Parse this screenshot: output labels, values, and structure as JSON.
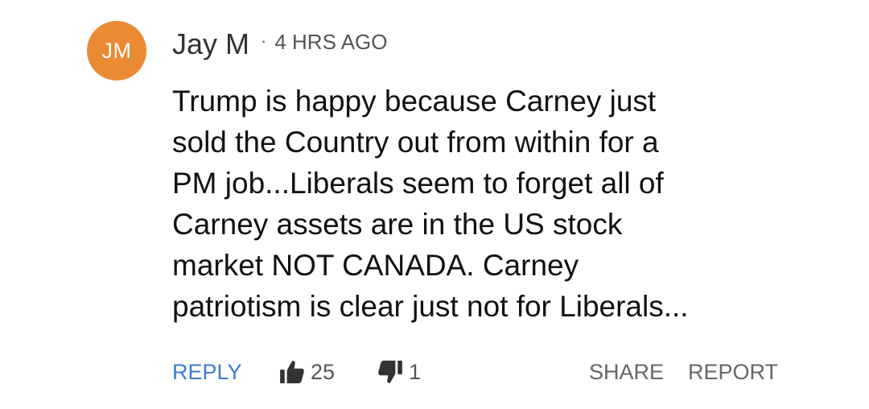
{
  "comment": {
    "avatar_initials": "JM",
    "avatar_color": "#ea8a33",
    "author": "Jay M",
    "separator": "·",
    "timestamp": "4 HRS AGO",
    "lines": [
      "Trump is happy because Carney just",
      "sold the Country out from within for a",
      "PM job...Liberals seem to forget all of",
      "Carney assets are in the US stock",
      "market NOT CANADA. Carney",
      "patriotism is clear just not for Liberals..."
    ]
  },
  "actions": {
    "reply_label": "REPLY",
    "like_icon": "thumbs-up-icon",
    "like_count": "25",
    "dislike_icon": "thumbs-down-icon",
    "dislike_count": "1",
    "share_label": "SHARE",
    "report_label": "REPORT",
    "accent_color": "#3a7bd5"
  }
}
